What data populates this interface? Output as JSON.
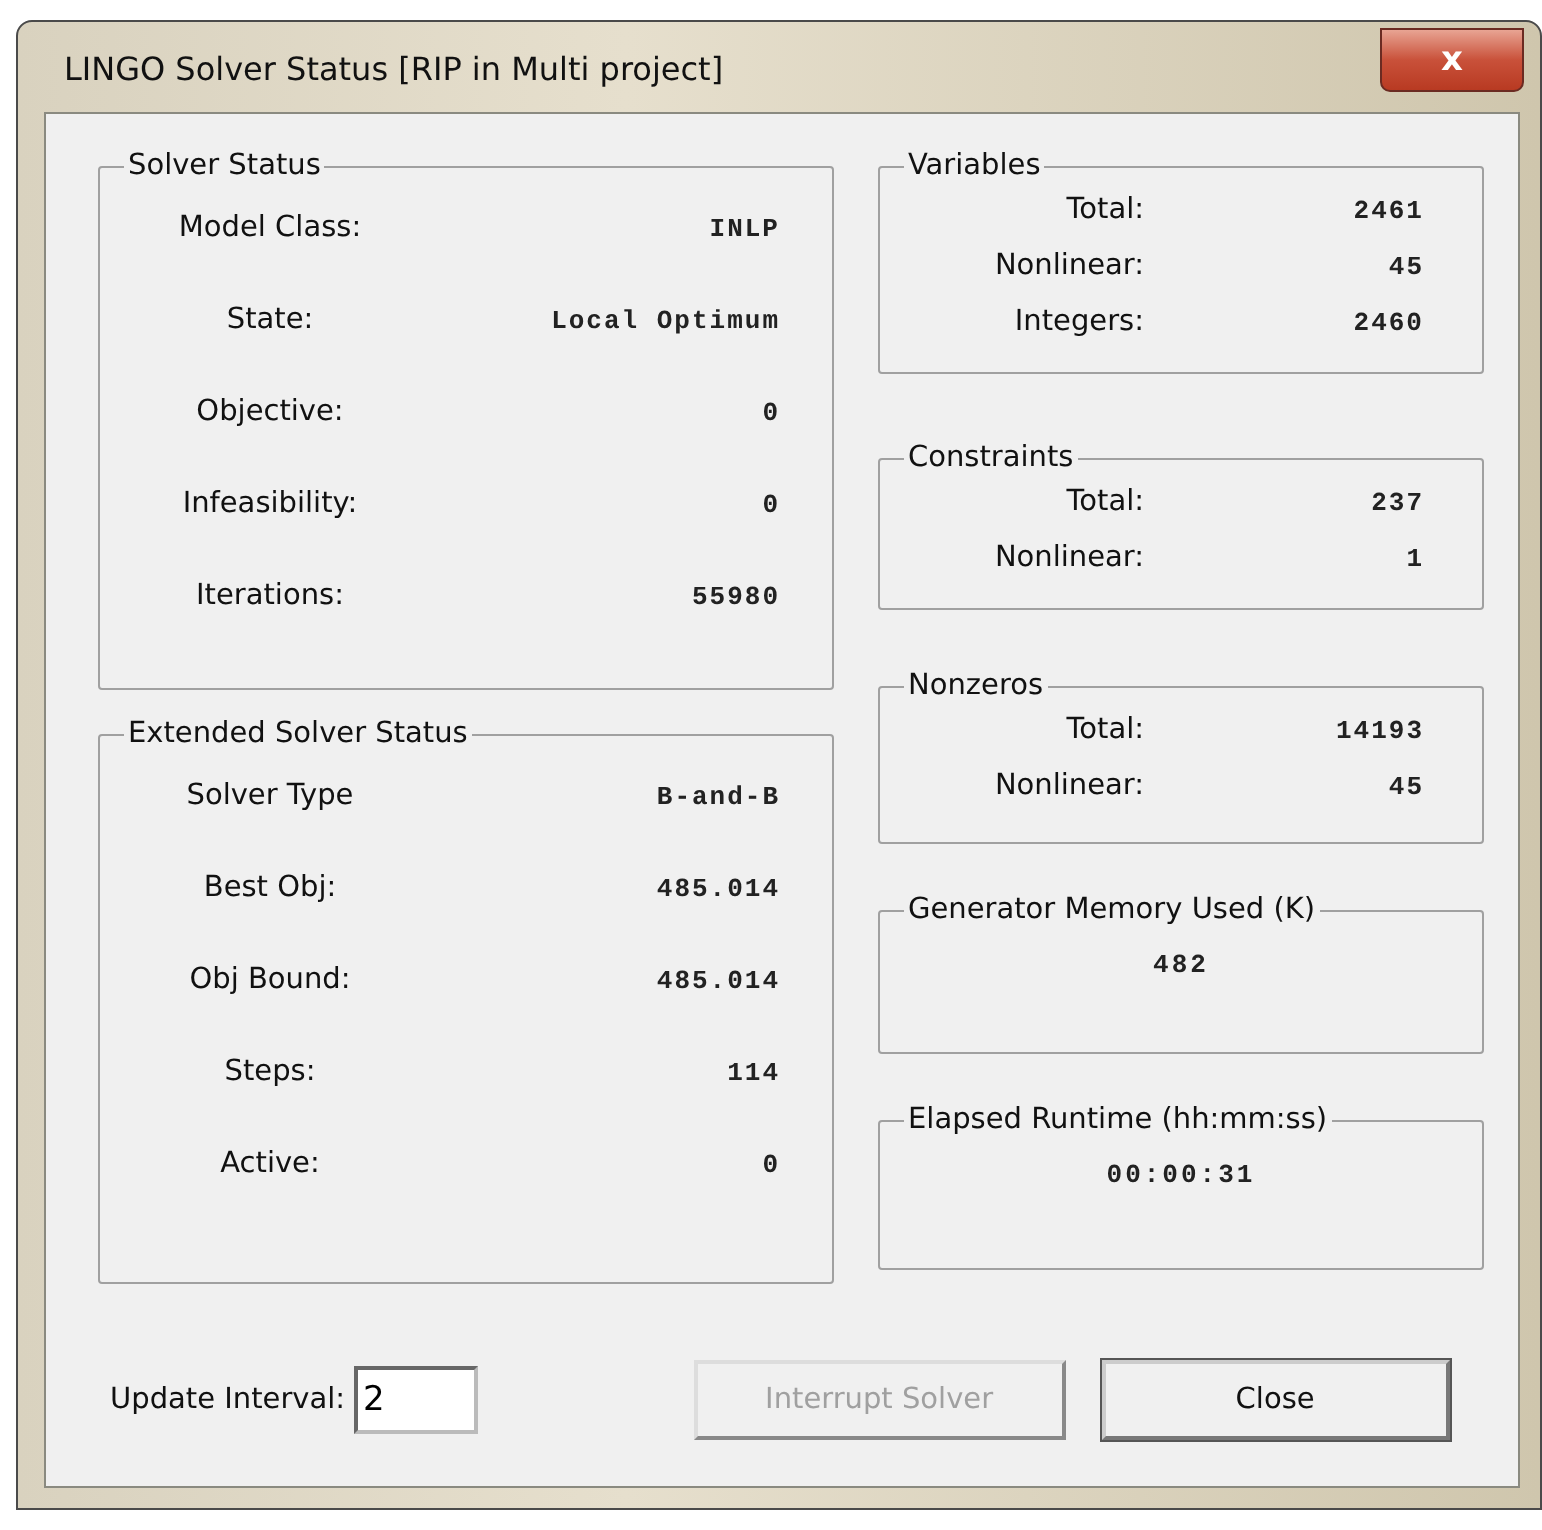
{
  "window": {
    "title": "LINGO Solver Status [RIP in Multi project]",
    "close": "x"
  },
  "left_groups": [
    {
      "title": "Solver Status",
      "rows": [
        {
          "label": "Model Class:",
          "value": "INLP"
        },
        {
          "label": "State:",
          "value": "Local Optimum"
        },
        {
          "label": "Objective:",
          "value": "0"
        },
        {
          "label": "Infeasibility:",
          "value": "0"
        },
        {
          "label": "Iterations:",
          "value": "55980"
        }
      ]
    },
    {
      "title": "Extended Solver Status",
      "rows": [
        {
          "label": "Solver Type",
          "value": "B-and-B"
        },
        {
          "label": "Best Obj:",
          "value": "485.014"
        },
        {
          "label": "Obj Bound:",
          "value": "485.014"
        },
        {
          "label": "Steps:",
          "value": "114"
        },
        {
          "label": "Active:",
          "value": "0"
        }
      ]
    }
  ],
  "right_groups": [
    {
      "title": "Variables",
      "rows": [
        {
          "label": "Total:",
          "value": "2461"
        },
        {
          "label": "Nonlinear:",
          "value": "45"
        },
        {
          "label": "Integers:",
          "value": "2460"
        }
      ]
    },
    {
      "title": "Constraints",
      "rows": [
        {
          "label": "Total:",
          "value": "237"
        },
        {
          "label": "Nonlinear:",
          "value": "1"
        }
      ]
    },
    {
      "title": "Nonzeros",
      "rows": [
        {
          "label": "Total:",
          "value": "14193"
        },
        {
          "label": "Nonlinear:",
          "value": "45"
        }
      ]
    },
    {
      "title": "Generator Memory Used (K)",
      "value": "482"
    },
    {
      "title": "Elapsed Runtime (hh:mm:ss)",
      "value": "00:00:31"
    }
  ],
  "update_interval": {
    "label": "Update Interval:",
    "value": "2"
  },
  "buttons": [
    {
      "label": "Interrupt Solver",
      "disabled": true
    },
    {
      "label": "Close",
      "disabled": false
    }
  ]
}
